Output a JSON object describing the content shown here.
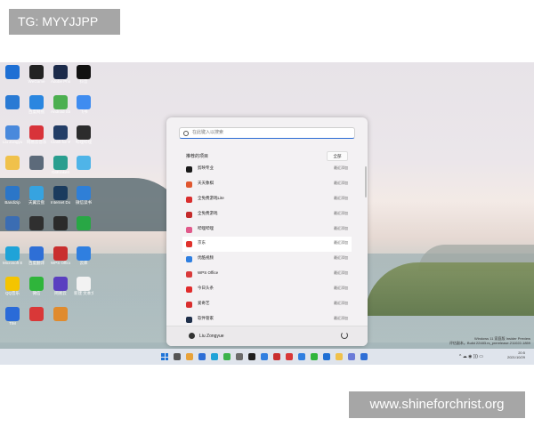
{
  "tag": "TG: MYYJJPP",
  "watermark": "www.shineforchrist.org",
  "desktop": {
    "icons": [
      {
        "label": "",
        "color": "#1e6fd4"
      },
      {
        "label": "WeGame",
        "color": "#222222"
      },
      {
        "label": "Adobe Photosho...",
        "color": "#1c2a4a"
      },
      {
        "label": "抖音",
        "color": "#111111"
      },
      {
        "label": "",
        "color": "#2a7ad4"
      },
      {
        "label": "百度网盘",
        "color": "#2a86e0"
      },
      {
        "label": "Android Studio",
        "color": "#4caf50"
      },
      {
        "label": "飞书",
        "color": "#3f8cf0"
      },
      {
        "label": "Liu Zongyue",
        "color": "#4a89dc"
      },
      {
        "label": "网易云音乐",
        "color": "#d8333a"
      },
      {
        "label": "Clash for Windows",
        "color": "#233d66"
      },
      {
        "label": "哔哩哔哩",
        "color": "#2c2c2c"
      },
      {
        "label": "",
        "color": "#f0c14b"
      },
      {
        "label": "",
        "color": "#5c6a7a"
      },
      {
        "label": "GitKraken",
        "color": "#2a9e8f"
      },
      {
        "label": "",
        "color": "#4fb4e8"
      },
      {
        "label": "Bandizip",
        "color": "#2b76c8"
      },
      {
        "label": "天翼云盘",
        "color": "#36a3e0"
      },
      {
        "label": "Internet Downloa...",
        "color": "#1a3b5e"
      },
      {
        "label": "微信读书",
        "color": "#2f7fd7"
      },
      {
        "label": "",
        "color": "#3b6db3"
      },
      {
        "label": "",
        "color": "#2f2f2f"
      },
      {
        "label": "",
        "color": "#2b2b2b"
      },
      {
        "label": "",
        "color": "#28a745"
      },
      {
        "label": "Microsoft Edge",
        "color": "#1fa3d8"
      },
      {
        "label": "百度翻译",
        "color": "#2e6fd6"
      },
      {
        "label": "WPS Office",
        "color": "#c92f2f"
      },
      {
        "label": "云库",
        "color": "#2f7fe0"
      },
      {
        "label": "QQ音乐",
        "color": "#f4c400"
      },
      {
        "label": "微信",
        "color": "#2fb53b"
      },
      {
        "label": "网易云",
        "color": "#5a3fc0"
      },
      {
        "label": "新建 文本文档.txt",
        "color": "#f2f2f2"
      },
      {
        "label": "TIM",
        "color": "#2a6bd8"
      },
      {
        "label": "",
        "color": "#d93838"
      },
      {
        "label": "",
        "color": "#e08b2e"
      }
    ]
  },
  "start_menu": {
    "search_placeholder": "在此键入以搜索",
    "recommended_title": "推荐的项目",
    "all_button": "全部",
    "items": [
      {
        "name": "剪映专业",
        "time": "最近添加",
        "color": "#1a1a1a"
      },
      {
        "name": "天天象棋",
        "color": "#e0572f",
        "time": "最近添加"
      },
      {
        "name": "全免费游戏Lite",
        "time": "最近添加",
        "color": "#d92e2e"
      },
      {
        "name": "全免费游戏",
        "time": "最近添加",
        "color": "#c42b2b"
      },
      {
        "name": "哔哩哔哩",
        "time": "最近添加",
        "color": "#e05a8a"
      },
      {
        "name": "京东",
        "time": "最近添加",
        "color": "#e0322c"
      },
      {
        "name": "优酷视频",
        "time": "最近添加",
        "color": "#2f7fe0"
      },
      {
        "name": "WPS Office",
        "time": "最近添加",
        "color": "#d93a3a"
      },
      {
        "name": "今日头条",
        "time": "最近添加",
        "color": "#e02c2c"
      },
      {
        "name": "爱奇艺",
        "time": "最近添加",
        "color": "#d92e2e"
      },
      {
        "name": "软件管家",
        "time": "最近添加",
        "color": "#1f2f4a"
      }
    ],
    "user_name": "Liu Zongyue"
  },
  "taskbar": {
    "time": "20:5",
    "date": "2021/10/29",
    "tray": "^ ☁ ◉ ))) ▭",
    "icon_colors": [
      "#555555",
      "#e8a33b",
      "#2e6fd6",
      "#1fa3d8",
      "#3bb34a",
      "#6b6b6b",
      "#1f1f1f",
      "#2f7fe0",
      "#c92f2f",
      "#d93838",
      "#2f7fe0",
      "#2fb53b",
      "#1e6fd4",
      "#f0c14b",
      "#6a7bd8",
      "#2e6fd6"
    ]
  },
  "desktop_info": {
    "line1": "Windows 11 家庭版 Insider Preview",
    "line2": "评估副本。Build 22483.rs_prerelease.211022-1859"
  }
}
